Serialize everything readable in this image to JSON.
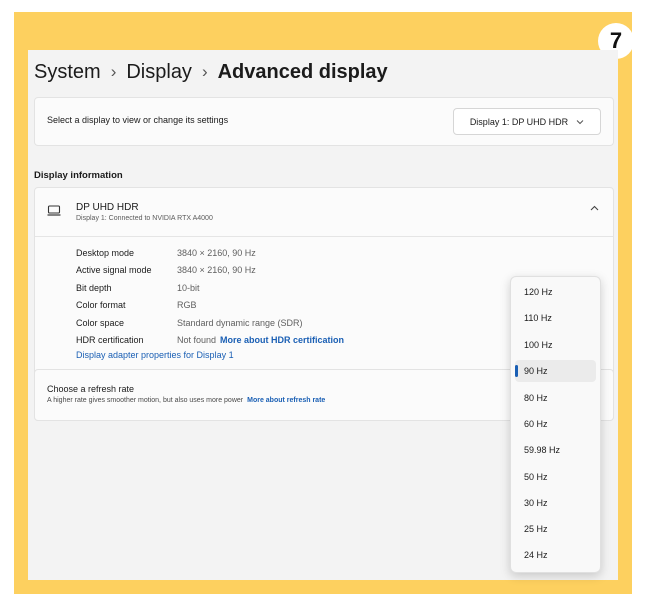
{
  "step_badge": "7",
  "breadcrumb": {
    "level1": "System",
    "level2": "Display",
    "current": "Advanced display"
  },
  "display_select": {
    "label": "Select a display to view or change its settings",
    "selected": "Display 1: DP UHD HDR"
  },
  "display_info": {
    "section_title": "Display information",
    "name": "DP UHD HDR",
    "subtitle": "Display 1: Connected to NVIDIA RTX A4000",
    "properties": [
      {
        "key": "Desktop mode",
        "value": "3840 × 2160, 90 Hz"
      },
      {
        "key": "Active signal mode",
        "value": "3840 × 2160, 90 Hz"
      },
      {
        "key": "Bit depth",
        "value": "10-bit"
      },
      {
        "key": "Color format",
        "value": "RGB"
      },
      {
        "key": "Color space",
        "value": "Standard dynamic range (SDR)"
      },
      {
        "key": "HDR certification",
        "value": "Not found",
        "link": "More about HDR certification"
      }
    ],
    "adapter_link": "Display adapter properties for Display 1"
  },
  "refresh_rate": {
    "title": "Choose a refresh rate",
    "description": "A higher rate gives smoother motion, but also uses more power",
    "link": "More about refresh rate",
    "options": [
      "120 Hz",
      "110 Hz",
      "100 Hz",
      "90 Hz",
      "80 Hz",
      "60 Hz",
      "59.98 Hz",
      "50 Hz",
      "30 Hz",
      "25 Hz",
      "24 Hz"
    ],
    "selected": "90 Hz"
  },
  "colors": {
    "frame": "#fdd05f",
    "accent": "#1a5fb4"
  }
}
